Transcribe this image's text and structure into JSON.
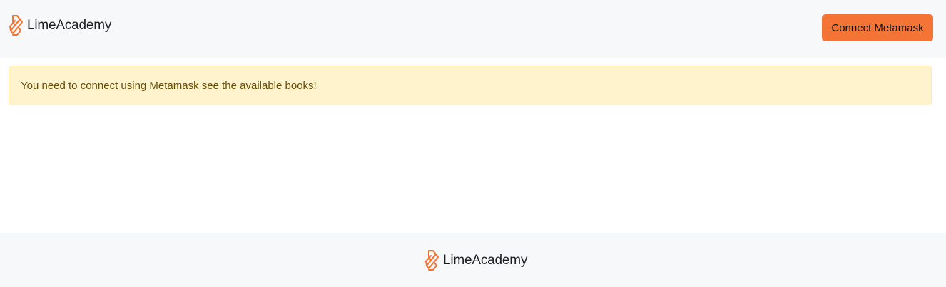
{
  "header": {
    "logo": {
      "icon": "lime-academy-logo-icon",
      "text_bold": "Lime",
      "text_light": "Academy"
    },
    "connect_button_label": "Connect Metamask"
  },
  "alert": {
    "message": "You need to connect using Metamask see the available books!"
  },
  "footer": {
    "logo": {
      "icon": "lime-academy-logo-icon",
      "text_bold": "Lime",
      "text_light": "Academy"
    }
  },
  "colors": {
    "accent": "#f47435",
    "header_bg": "#f7f8fa",
    "alert_bg": "#fff3cd",
    "alert_text": "#664d03"
  }
}
